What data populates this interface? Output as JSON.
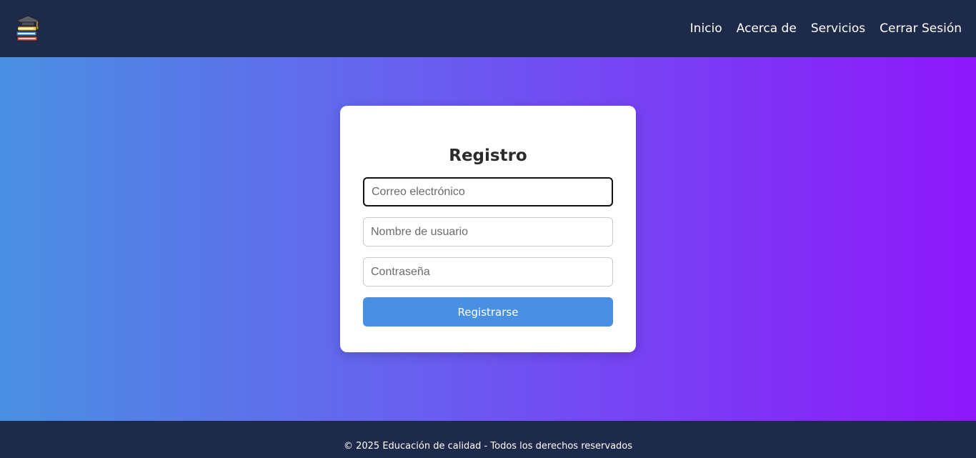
{
  "header": {
    "logo_icon": "books-graduation-cap-icon",
    "nav": [
      {
        "label": "Inicio"
      },
      {
        "label": "Acerca de"
      },
      {
        "label": "Servicios"
      },
      {
        "label": "Cerrar Sesión"
      }
    ]
  },
  "form": {
    "title": "Registro",
    "email_placeholder": "Correo electrónico",
    "username_placeholder": "Nombre de usuario",
    "password_placeholder": "Contraseña",
    "submit_label": "Registrarse"
  },
  "footer": {
    "text": "© 2025 Educación de calidad - Todos los derechos reservados"
  },
  "colors": {
    "navbar_bg": "#1e2a4a",
    "gradient_start": "#4a90e2",
    "gradient_end": "#8e17fb",
    "button_bg": "#4a90e2"
  }
}
